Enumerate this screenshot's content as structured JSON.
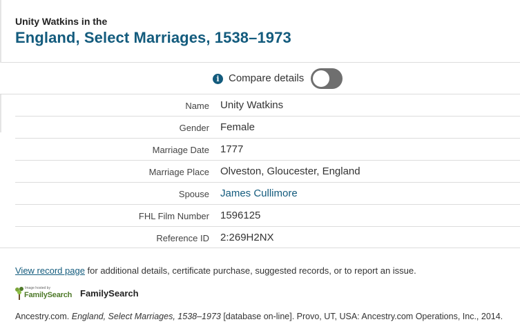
{
  "header": {
    "subtitle": "Unity Watkins in the",
    "title": "England, Select Marriages, 1538–1973"
  },
  "compare": {
    "label": "Compare details",
    "info_icon": "info-icon",
    "toggle_state": "off"
  },
  "details": [
    {
      "key": "Name",
      "value": "Unity Watkins",
      "link": false
    },
    {
      "key": "Gender",
      "value": "Female",
      "link": false
    },
    {
      "key": "Marriage Date",
      "value": "1777",
      "link": false
    },
    {
      "key": "Marriage Place",
      "value": "Olveston, Gloucester, England",
      "link": false
    },
    {
      "key": "Spouse",
      "value": "James Cullimore",
      "link": true
    },
    {
      "key": "FHL Film Number",
      "value": "1596125",
      "link": false
    },
    {
      "key": "Reference ID",
      "value": "2:269H2NX",
      "link": false
    }
  ],
  "footer": {
    "link_text": "View record page",
    "note_text": " for additional details, certificate purchase, suggested records, or to report an issue.",
    "logo_hosted": "Image hosted by",
    "logo_brand": "FamilySearch",
    "source_name": "FamilySearch"
  },
  "citation": {
    "prefix": "Ancestry.com. ",
    "title": "England, Select Marriages, 1538–1973",
    "suffix": " [database on-line]. Provo, UT, USA: Ancestry.com Operations, Inc., 2014."
  },
  "colors": {
    "accent": "#135b7d",
    "toggle_off": "#6f6f6f",
    "familysearch_green": "#4f7a2a"
  }
}
